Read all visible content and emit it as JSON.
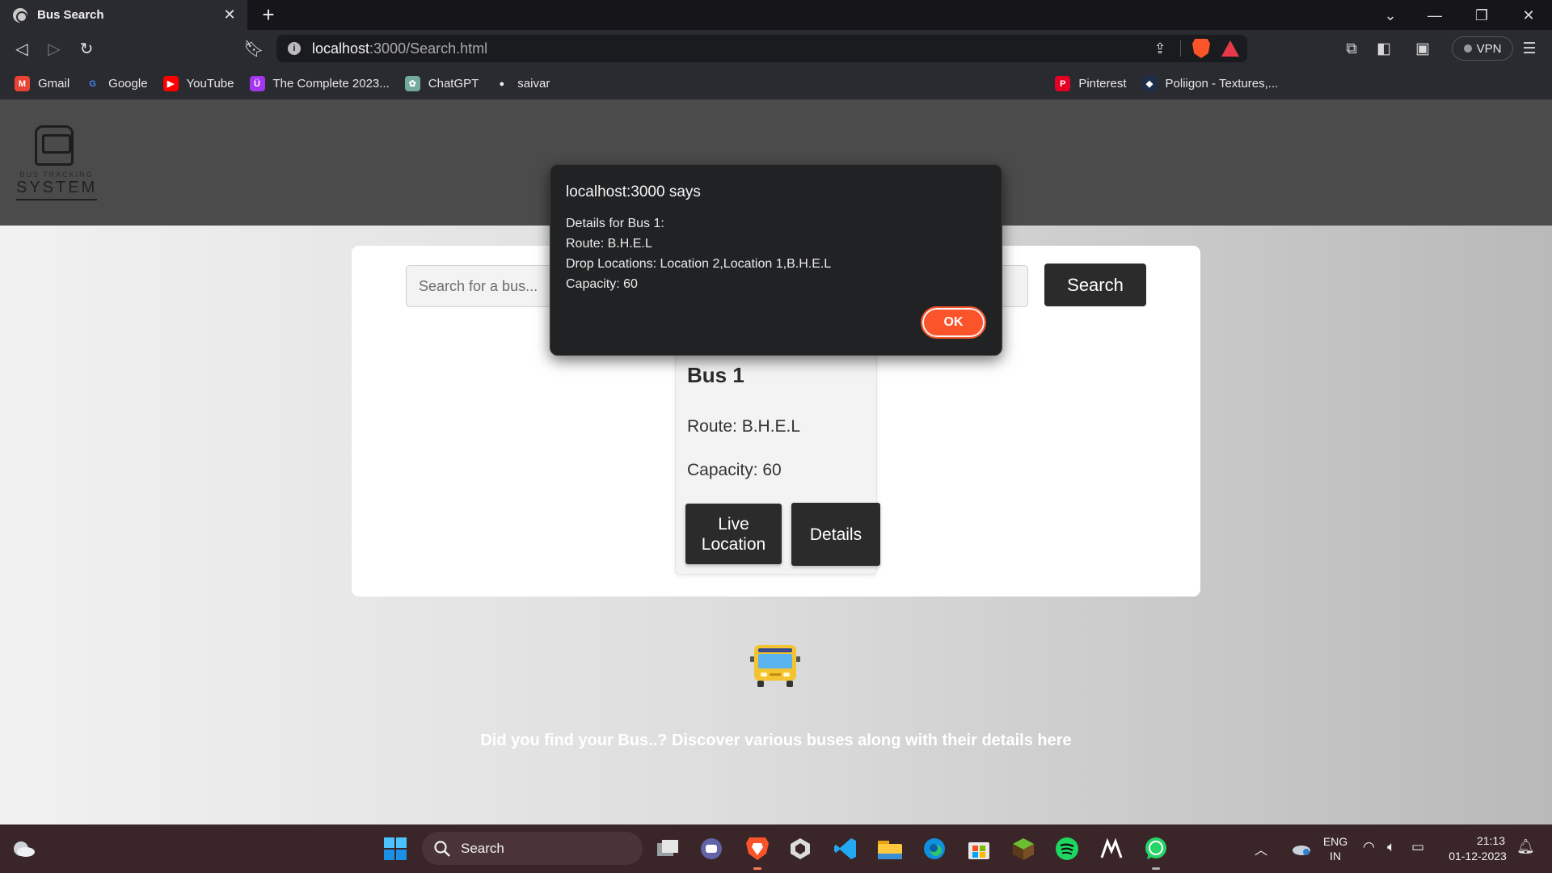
{
  "browser": {
    "tab_title": "Bus Search",
    "tab_close": "✕",
    "new_tab": "+",
    "url_host": "localhost",
    "url_path": ":3000/Search.html",
    "vpn_label": "VPN",
    "bookmarks": [
      {
        "label": "Gmail",
        "icon": "gmail-icon",
        "color": "#ea4335",
        "glyph": "M"
      },
      {
        "label": "Google",
        "icon": "google-icon",
        "color": "#ffffff",
        "glyph": "G"
      },
      {
        "label": "YouTube",
        "icon": "youtube-icon",
        "color": "#ff0000",
        "glyph": "▶"
      },
      {
        "label": "The Complete 2023...",
        "icon": "udemy-icon",
        "color": "#a435f0",
        "glyph": "Ü"
      },
      {
        "label": "ChatGPT",
        "icon": "chatgpt-icon",
        "color": "#74aa9c",
        "glyph": "✿"
      },
      {
        "label": "saivar",
        "icon": "github-icon",
        "color": "#f0f0f0",
        "glyph": "●"
      },
      {
        "label": "Pinterest",
        "icon": "pinterest-icon",
        "color": "#e60023",
        "glyph": "P"
      },
      {
        "label": "Poliigon - Textures,...",
        "icon": "poliigon-icon",
        "color": "#1e2e4a",
        "glyph": "◆"
      }
    ]
  },
  "header": {
    "logo_small": "BUS TRACKING",
    "logo_big": "SYSTEM"
  },
  "search": {
    "placeholder": "Search for a bus...",
    "value": "",
    "button_label": "Search"
  },
  "bus_card": {
    "title": "Bus 1",
    "route": "Route: B.H.E.L",
    "capacity": "Capacity: 60",
    "live_location_label": "Live Location",
    "details_label": "Details"
  },
  "tagline": "Did you find your Bus..? Discover various buses along with their details here",
  "dialog": {
    "title": "localhost:3000 says",
    "lines": [
      "Details for Bus 1:",
      "Route: B.H.E.L",
      "Drop Locations: Location 2,Location 1,B.H.E.L",
      "Capacity: 60"
    ],
    "ok_label": "OK"
  },
  "taskbar": {
    "search_label": "Search",
    "lang_top": "ENG",
    "lang_bottom": "IN",
    "time": "21:13",
    "date": "01-12-2023"
  },
  "colors": {
    "brave_orange": "#fb542b",
    "button_dark": "#2b2b2b",
    "header_gray": "#4b4b4b"
  }
}
